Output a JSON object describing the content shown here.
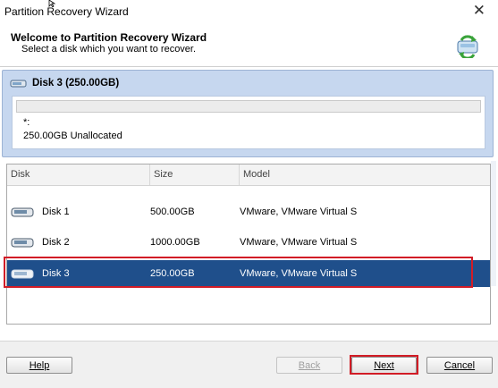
{
  "window": {
    "title": "Partition Recovery Wizard"
  },
  "header": {
    "title": "Welcome to Partition Recovery Wizard",
    "subtitle": "Select a disk which you want to recover."
  },
  "selected_disk": {
    "label": "Disk 3 (250.00GB)",
    "partition_name": "*:",
    "partition_desc": "250.00GB Unallocated"
  },
  "table": {
    "columns": [
      "Disk",
      "Size",
      "Model"
    ],
    "rows": [
      {
        "disk": "Disk 1",
        "size": "500.00GB",
        "model": "VMware, VMware Virtual S",
        "selected": false
      },
      {
        "disk": "Disk 2",
        "size": "1000.00GB",
        "model": "VMware, VMware Virtual S",
        "selected": false
      },
      {
        "disk": "Disk 3",
        "size": "250.00GB",
        "model": "VMware, VMware Virtual S",
        "selected": true
      }
    ]
  },
  "buttons": {
    "help": "Help",
    "back": "Back",
    "next": "Next",
    "cancel": "Cancel"
  },
  "colors": {
    "selected_row": "#1f4f8b",
    "highlight": "#d21c26",
    "panel": "#c6d7ef"
  }
}
